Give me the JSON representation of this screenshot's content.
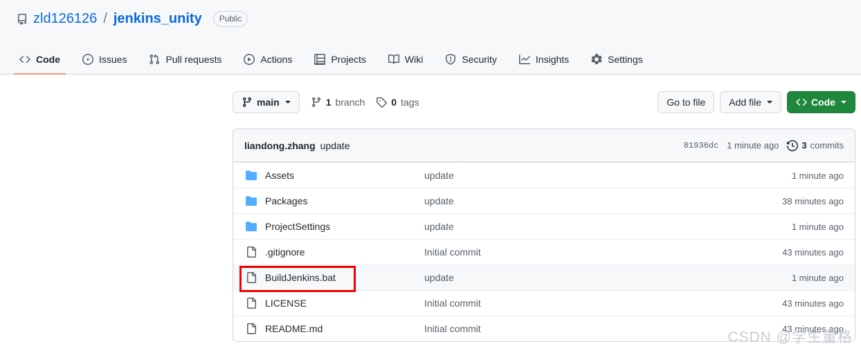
{
  "header": {
    "repo_icon": "repo-icon",
    "owner": "zld126126",
    "separator": "/",
    "name": "jenkins_unity",
    "visibility": "Public"
  },
  "nav": {
    "items": [
      {
        "label": "Code",
        "icon": "code-icon",
        "active": true
      },
      {
        "label": "Issues",
        "icon": "issue-opened-icon",
        "active": false
      },
      {
        "label": "Pull requests",
        "icon": "git-pull-request-icon",
        "active": false
      },
      {
        "label": "Actions",
        "icon": "play-icon",
        "active": false
      },
      {
        "label": "Projects",
        "icon": "table-icon",
        "active": false
      },
      {
        "label": "Wiki",
        "icon": "book-icon",
        "active": false
      },
      {
        "label": "Security",
        "icon": "shield-icon",
        "active": false
      },
      {
        "label": "Insights",
        "icon": "graph-icon",
        "active": false
      },
      {
        "label": "Settings",
        "icon": "gear-icon",
        "active": false
      }
    ]
  },
  "toolbar": {
    "branch_selector": "main",
    "branch_count": "1",
    "branch_label": "branch",
    "tag_count": "0",
    "tag_label": "tags",
    "go_to_file": "Go to file",
    "add_file": "Add file",
    "code_button": "Code"
  },
  "commit_bar": {
    "author": "liandong.zhang",
    "message": "update",
    "sha": "81936dc",
    "time": "1 minute ago",
    "commit_count": "3",
    "commit_label": "commits"
  },
  "files": [
    {
      "name": "Assets",
      "type": "folder",
      "message": "update",
      "time": "1 minute ago",
      "highlighted": false
    },
    {
      "name": "Packages",
      "type": "folder",
      "message": "update",
      "time": "38 minutes ago",
      "highlighted": false
    },
    {
      "name": "ProjectSettings",
      "type": "folder",
      "message": "update",
      "time": "1 minute ago",
      "highlighted": false
    },
    {
      "name": ".gitignore",
      "type": "file",
      "message": "Initial commit",
      "time": "43 minutes ago",
      "highlighted": false
    },
    {
      "name": "BuildJenkins.bat",
      "type": "file",
      "message": "update",
      "time": "1 minute ago",
      "highlighted": true
    },
    {
      "name": "LICENSE",
      "type": "file",
      "message": "Initial commit",
      "time": "43 minutes ago",
      "highlighted": false
    },
    {
      "name": "README.md",
      "type": "file",
      "message": "Initial commit",
      "time": "43 minutes ago",
      "highlighted": false
    }
  ],
  "watermark": {
    "text": "CSDN @学生董格"
  },
  "colors": {
    "link": "#0969da",
    "accent_underline": "#fd8c73",
    "code_button": "#1f883d",
    "folder_icon": "#54aeff",
    "annotation": "#ee0000",
    "header_bg": "#f6f8fa",
    "border": "#d0d7de"
  }
}
